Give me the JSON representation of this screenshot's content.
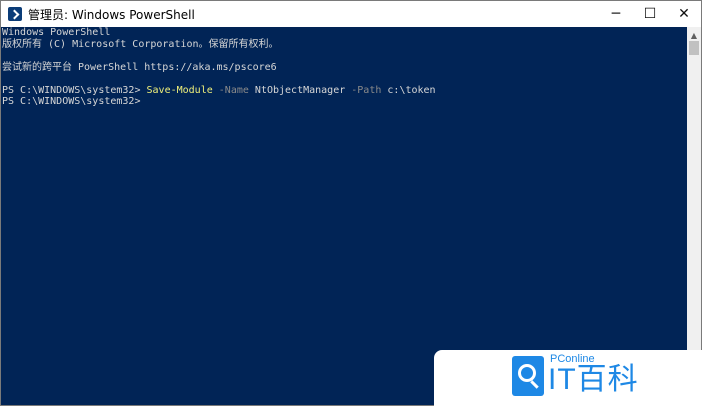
{
  "window": {
    "title": "管理员: Windows PowerShell",
    "controls": {
      "minimize": "─",
      "maximize": "☐",
      "close": "✕"
    }
  },
  "console": {
    "lines": [
      "Windows PowerShell",
      "版权所有 (C) Microsoft Corporation。保留所有权利。",
      "",
      "尝试新的跨平台 PowerShell https://aka.ms/pscore6",
      "",
      "PS C:\\WINDOWS\\system32>",
      "PS C:\\WINDOWS\\system32>"
    ],
    "command": {
      "cmdlet": "Save-Module",
      "param1": "-Name",
      "value1": "NtObjectManager",
      "param2": "-Path",
      "value2": "c:\\token"
    },
    "colors": {
      "background": "#012456",
      "text": "#d6d6d6",
      "cmdlet": "#f0f07a",
      "parameter": "#8a8a8a"
    }
  },
  "scrollbar": {
    "up_arrow": "▲"
  },
  "watermark": {
    "brand": "PConline",
    "text": "IT百科",
    "icon": "search-magnifier-icon",
    "color": "#1e88e5"
  }
}
